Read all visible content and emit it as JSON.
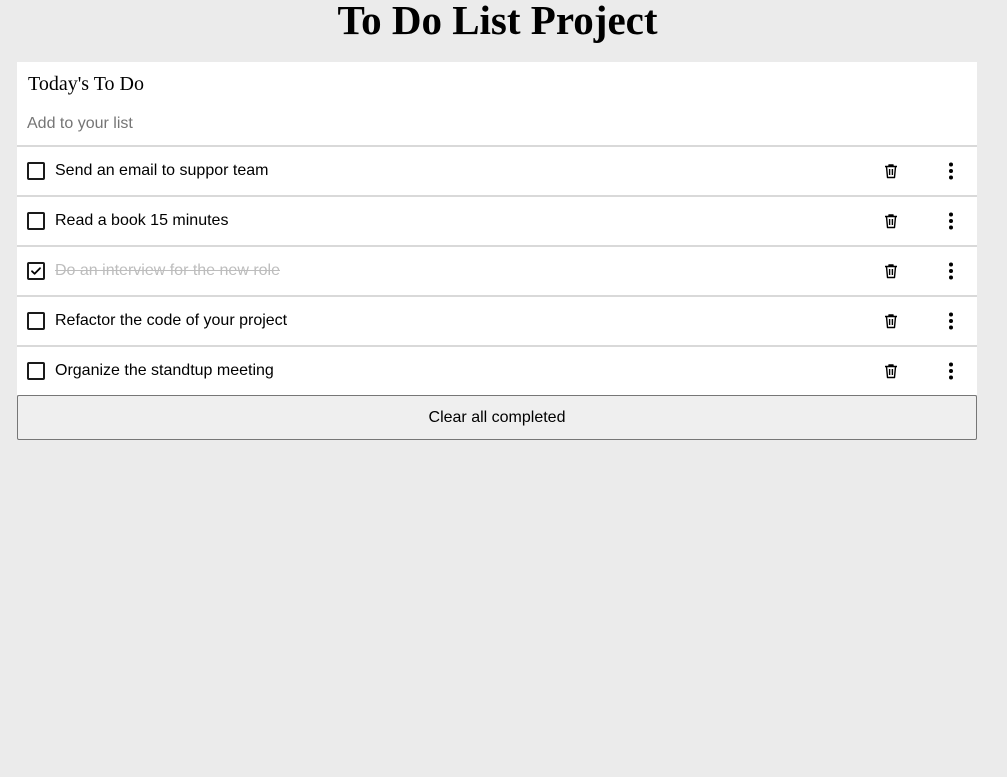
{
  "app": {
    "title": "To Do List Project"
  },
  "card": {
    "heading": "Today's To Do",
    "add_input": {
      "placeholder": "Add to your list",
      "value": ""
    }
  },
  "tasks": [
    {
      "text": "Send an email to suppor team",
      "completed": false
    },
    {
      "text": "Read a book 15 minutes",
      "completed": false
    },
    {
      "text": "Do an interview for the new role",
      "completed": true
    },
    {
      "text": "Refactor the code of your project",
      "completed": false
    },
    {
      "text": "Organize the standtup meeting",
      "completed": false
    }
  ],
  "icons": {
    "delete": "trash-icon",
    "more": "kebab-menu-icon",
    "check": "checkmark-icon"
  },
  "clear_button": {
    "label": "Clear all completed"
  },
  "colors": {
    "background": "#ebebeb",
    "card": "#ffffff",
    "divider": "#d9d9d9",
    "completed_text": "#bdbdbd"
  }
}
